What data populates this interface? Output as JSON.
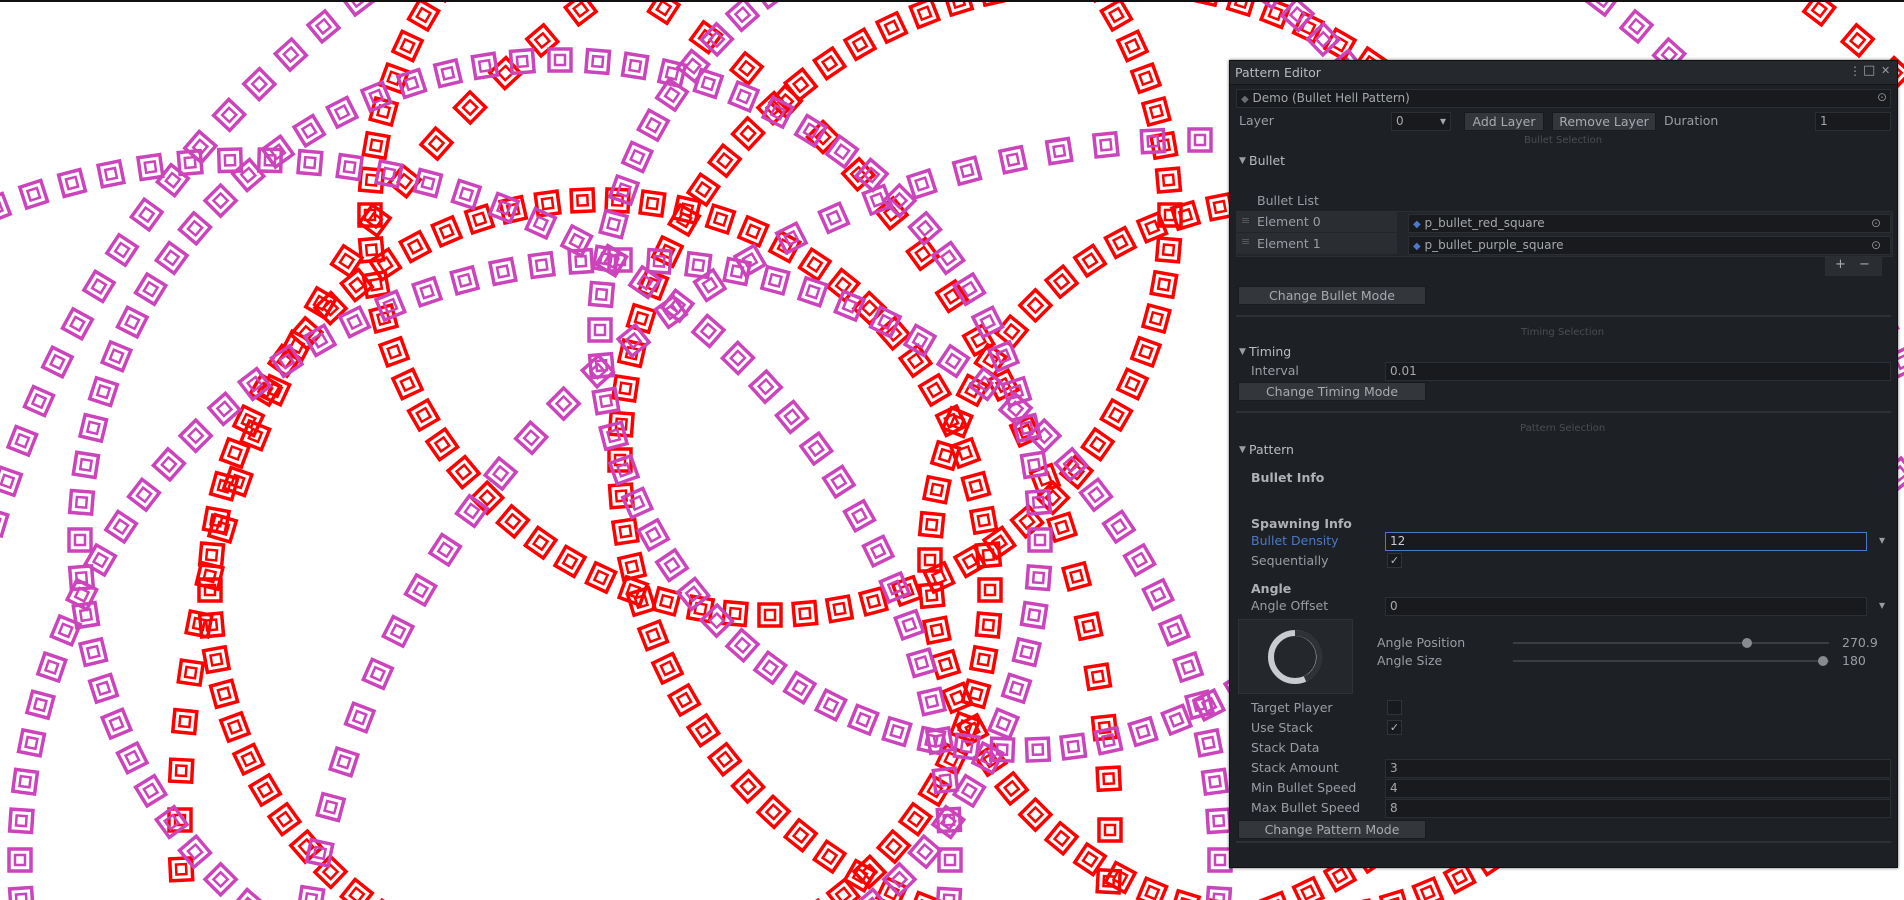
{
  "window": {
    "title": "Pattern Editor"
  },
  "asset": {
    "name": "Demo (Bullet Hell Pattern)"
  },
  "layer_row": {
    "label": "Layer",
    "value": "0",
    "add_label": "Add Layer",
    "remove_label": "Remove Layer",
    "duration_label": "Duration",
    "duration_value": "1"
  },
  "bullet_section": {
    "caption": "Bullet Selection",
    "header": "Bullet",
    "list_label": "Bullet List",
    "elements": [
      {
        "label": "Element 0",
        "value": "p_bullet_red_square"
      },
      {
        "label": "Element 1",
        "value": "p_bullet_purple_square"
      }
    ],
    "plus": "+",
    "minus": "−",
    "mode_button": "Change Bullet Mode"
  },
  "timing_section": {
    "caption": "Timing Selection",
    "header": "Timing",
    "interval_label": "Interval",
    "interval_value": "0.01",
    "mode_button": "Change Timing Mode"
  },
  "pattern_section": {
    "caption": "Pattern Selection",
    "header": "Pattern",
    "bullet_info": "Bullet Info",
    "spawning_info": "Spawning Info",
    "density_label": "Bullet Density",
    "density_value": "12",
    "sequential_label": "Sequentially",
    "angle_header": "Angle",
    "angle_offset_label": "Angle Offset",
    "angle_offset_value": "0",
    "angle_position_label": "Angle Position",
    "angle_position_value": "270.9",
    "angle_position_fraction": 0.74,
    "angle_size_label": "Angle Size",
    "angle_size_value": "180",
    "angle_size_fraction": 0.98,
    "target_player_label": "Target Player",
    "use_stack_label": "Use Stack",
    "stack_data_label": "Stack Data",
    "stack_amount_label": "Stack Amount",
    "stack_amount_value": "3",
    "min_speed_label": "Min Bullet Speed",
    "min_speed_value": "4",
    "max_speed_label": "Max Bullet Speed",
    "max_speed_value": "8",
    "mode_button": "Change Pattern Mode"
  },
  "checks": {
    "sequential": "✓",
    "use_stack": "✓"
  },
  "colors": {
    "red_bullet": "#ff0000",
    "purple_bullet": "#cc44bb",
    "panel_bg": "#1d2024",
    "accent": "#4c78c8"
  },
  "icons": {
    "menu": "⋮",
    "maximize": "□",
    "close": "✕",
    "target": "⊙",
    "prefab": "◆",
    "dropdown": "▾",
    "foldout": "▼",
    "drag": "≡"
  }
}
